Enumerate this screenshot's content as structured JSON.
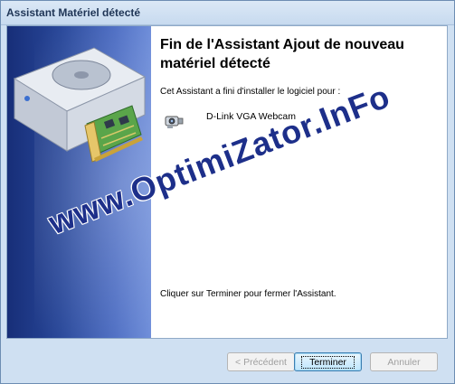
{
  "window": {
    "title": "Assistant Matériel détecté"
  },
  "main": {
    "title": "Fin de l'Assistant Ajout de nouveau matériel détecté",
    "intro": "Cet Assistant a fini d'installer le logiciel pour :",
    "device": {
      "name": "D-Link VGA Webcam",
      "icon": "webcam-icon"
    },
    "finish_text": "Cliquer sur Terminer pour fermer l'Assistant."
  },
  "watermark": {
    "text": "www.OptimiZator.InFo"
  },
  "buttons": {
    "previous": "< Précédent",
    "finish": "Terminer",
    "cancel": "Annuler"
  },
  "colors": {
    "sidebar": "#29489a",
    "titlebar": "#c7daef",
    "watermark": "#1d2f8a"
  }
}
